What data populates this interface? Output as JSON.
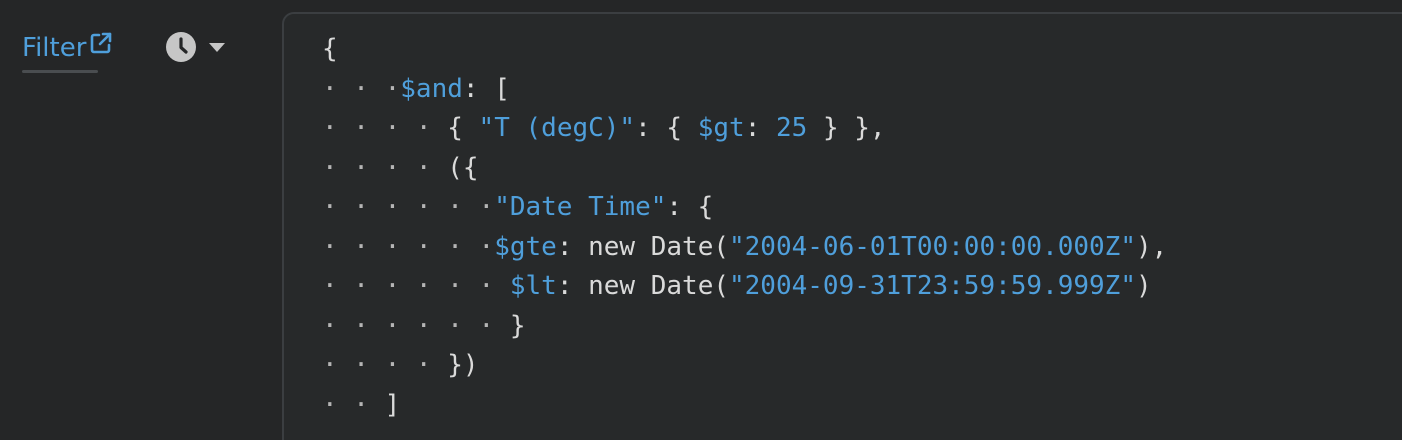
{
  "filter": {
    "label": "Filter",
    "external_icon": "external-link-icon",
    "history_icon": "clock-icon",
    "dropdown_icon": "caret-down-icon"
  },
  "colors": {
    "background": "#252627",
    "editor_background": "#27292a",
    "editor_border": "#3b3e41",
    "accent": "#4f9fdb",
    "text": "#d9d9d9",
    "icon": "#c6c6c6"
  },
  "editor": {
    "lines": [
      [
        {
          "t": "txt",
          "v": "{"
        }
      ],
      [
        {
          "t": "dot",
          "v": "· · ·"
        },
        {
          "t": "key",
          "v": "$and"
        },
        {
          "t": "txt",
          "v": ": ["
        }
      ],
      [
        {
          "t": "dot",
          "v": "· · · · "
        },
        {
          "t": "txt",
          "v": "{ "
        },
        {
          "t": "str",
          "v": "\"T (degC)\""
        },
        {
          "t": "txt",
          "v": ": { "
        },
        {
          "t": "key",
          "v": "$gt"
        },
        {
          "t": "txt",
          "v": ": "
        },
        {
          "t": "num",
          "v": "25"
        },
        {
          "t": "txt",
          "v": " } },"
        }
      ],
      [
        {
          "t": "dot",
          "v": "· · · · "
        },
        {
          "t": "txt",
          "v": "({"
        }
      ],
      [
        {
          "t": "dot",
          "v": "· · · · · ·"
        },
        {
          "t": "str",
          "v": "\"Date Time\""
        },
        {
          "t": "txt",
          "v": ": {"
        }
      ],
      [
        {
          "t": "dot",
          "v": "· · · · · ·"
        },
        {
          "t": "key",
          "v": "$gte"
        },
        {
          "t": "txt",
          "v": ": new Date("
        },
        {
          "t": "str",
          "v": "\"2004-06-01T00:00:00.000Z\""
        },
        {
          "t": "txt",
          "v": "),"
        }
      ],
      [
        {
          "t": "dot",
          "v": "· · · · · · "
        },
        {
          "t": "key",
          "v": "$lt"
        },
        {
          "t": "txt",
          "v": ": new Date("
        },
        {
          "t": "str",
          "v": "\"2004-09-31T23:59:59.999Z\""
        },
        {
          "t": "txt",
          "v": ")"
        }
      ],
      [
        {
          "t": "dot",
          "v": "· · · · · · "
        },
        {
          "t": "txt",
          "v": "}"
        }
      ],
      [
        {
          "t": "dot",
          "v": "· · · · "
        },
        {
          "t": "txt",
          "v": "})"
        }
      ],
      [
        {
          "t": "dot",
          "v": "· · "
        },
        {
          "t": "txt",
          "v": "]"
        }
      ]
    ]
  }
}
